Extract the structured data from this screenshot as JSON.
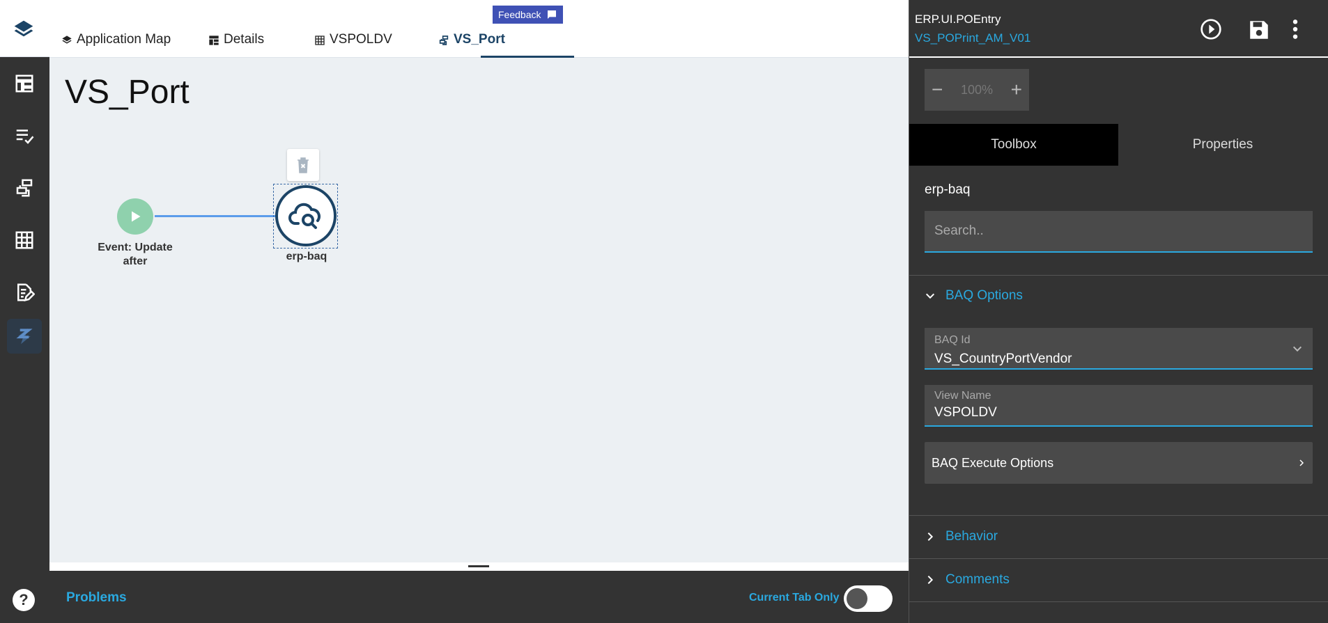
{
  "tabs": [
    {
      "label": "Application Map",
      "icon": "layers-icon"
    },
    {
      "label": "Details",
      "icon": "layout-icon"
    },
    {
      "label": "VSPOLDV",
      "icon": "grid-icon"
    },
    {
      "label": "VS_Port",
      "icon": "hierarchy-icon",
      "active": true
    }
  ],
  "feedback": {
    "label": "Feedback"
  },
  "rail": {
    "items": [
      "layout-icon",
      "checklist-icon",
      "hierarchy-icon",
      "grid-icon",
      "edit-doc-icon",
      "event-icon"
    ],
    "active": "event-icon",
    "help": "?"
  },
  "canvas": {
    "title": "VS_Port",
    "start_node_label": "Event: Update after",
    "baq_node_label": "erp-baq"
  },
  "problems": {
    "label": "Problems",
    "current_tab_label": "Current Tab Only",
    "current_tab_on": false
  },
  "panel": {
    "app_name": "ERP.UI.POEntry",
    "layer_name": "VS_POPrint_AM_V01",
    "zoom": {
      "minus": "−",
      "value": "100%",
      "plus": "+"
    },
    "tabs": [
      "Toolbox",
      "Properties"
    ],
    "active_tab": "Toolbox",
    "section_name": "erp-baq",
    "search_placeholder": "Search..",
    "baq_options": {
      "title": "BAQ Options",
      "baq_id_label": "BAQ Id",
      "baq_id_value": "VS_CountryPortVendor",
      "view_name_label": "View Name",
      "view_name_value": "VSPOLDV",
      "execute_label": "BAQ Execute Options"
    },
    "behavior": "Behavior",
    "comments": "Comments"
  },
  "colors": {
    "dark_bg": "#333333",
    "accent": "#2aa9e0",
    "navy": "#1c4466",
    "start_green": "#8fd1ad",
    "edge_blue": "#5b9cea",
    "canvas_bg": "#ecf0f3"
  }
}
